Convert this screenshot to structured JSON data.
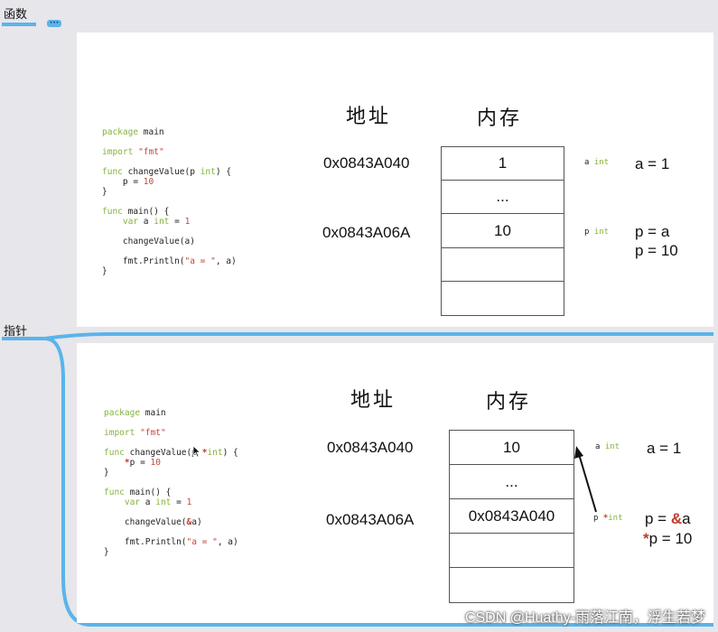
{
  "mindmap": {
    "topic1": "函数",
    "topic1_more": "•••",
    "topic2": "指针",
    "line_color": "#5ab4ea"
  },
  "slide1": {
    "header_addr": "地址",
    "header_mem": "内存",
    "code": [
      "package main",
      "import \"fmt\"",
      "func changeValue(p int) {",
      "    p = 10",
      "}",
      "func main() {",
      "    var a int = 1",
      "    changeValue(a)",
      "    fmt.Println(\"a = \", a)",
      "}"
    ],
    "addr1": "0x0843A040",
    "addr2": "0x0843A06A",
    "cells": [
      "1",
      "...",
      "10",
      "",
      ""
    ],
    "var_a": "a",
    "var_a_type": "int",
    "var_p": "p",
    "var_p_type": "int",
    "eq_a": "a = 1",
    "eq_p1": "p = a",
    "eq_p2": "p = 10"
  },
  "slide2": {
    "header_addr": "地址",
    "header_mem": "内存",
    "addr1": "0x0843A040",
    "addr2": "0x0843A06A",
    "cells": [
      "10",
      "...",
      "0x0843A040",
      "",
      ""
    ],
    "var_a": "a",
    "var_a_type": "int",
    "var_p": "p",
    "var_p_star": "*",
    "var_p_type": "int",
    "eq_a": "a = 1",
    "eq_p1_pre": "p = ",
    "eq_p1_op": "&",
    "eq_p1_post": "a",
    "eq_p2_op": "*",
    "eq_p2_post": "p = 10"
  },
  "watermark": "CSDN @Huathy-雨落江南，浮生若梦"
}
